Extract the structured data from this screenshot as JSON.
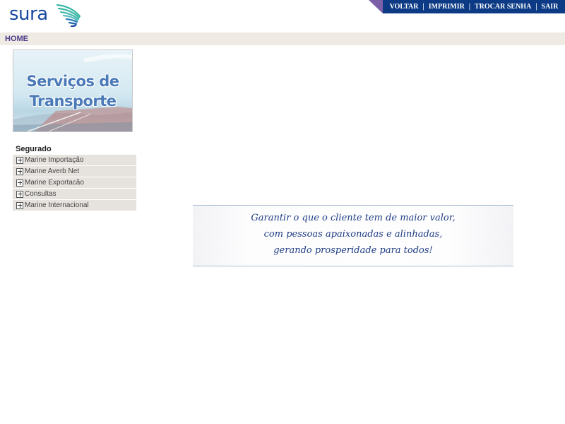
{
  "header": {
    "logo_text": "sura",
    "logo_icon": "sura-wing-logo",
    "brand_color": "#1a4aa0",
    "accent_color": "#0c3a85",
    "tab_color": "#7b5fa8"
  },
  "topnav": {
    "items": [
      {
        "label": "VOLTAR"
      },
      {
        "label": "IMPRIMIR"
      },
      {
        "label": "TROCAR SENHA"
      },
      {
        "label": "SAIR"
      }
    ],
    "separator": "|"
  },
  "breadcrumb": {
    "home_label": "HOME"
  },
  "banner": {
    "line1": "Serviços de",
    "line2": "Transporte"
  },
  "sidebar": {
    "title": "Segurado",
    "items": [
      {
        "label": "Marine Importação",
        "icon": "plus-box-icon"
      },
      {
        "label": "Marine Averb Net",
        "icon": "plus-box-icon"
      },
      {
        "label": "Marine Exportacão",
        "icon": "plus-box-icon"
      },
      {
        "label": "Consultas",
        "icon": "plus-box-icon"
      },
      {
        "label": "Marine Internacional",
        "icon": "plus-box-icon"
      }
    ]
  },
  "slogan": {
    "line1": "Garantir o que o cliente tem de maior valor,",
    "line2": "com pessoas apaixonadas e alinhadas,",
    "line3": "gerando prosperidade para todos!"
  }
}
